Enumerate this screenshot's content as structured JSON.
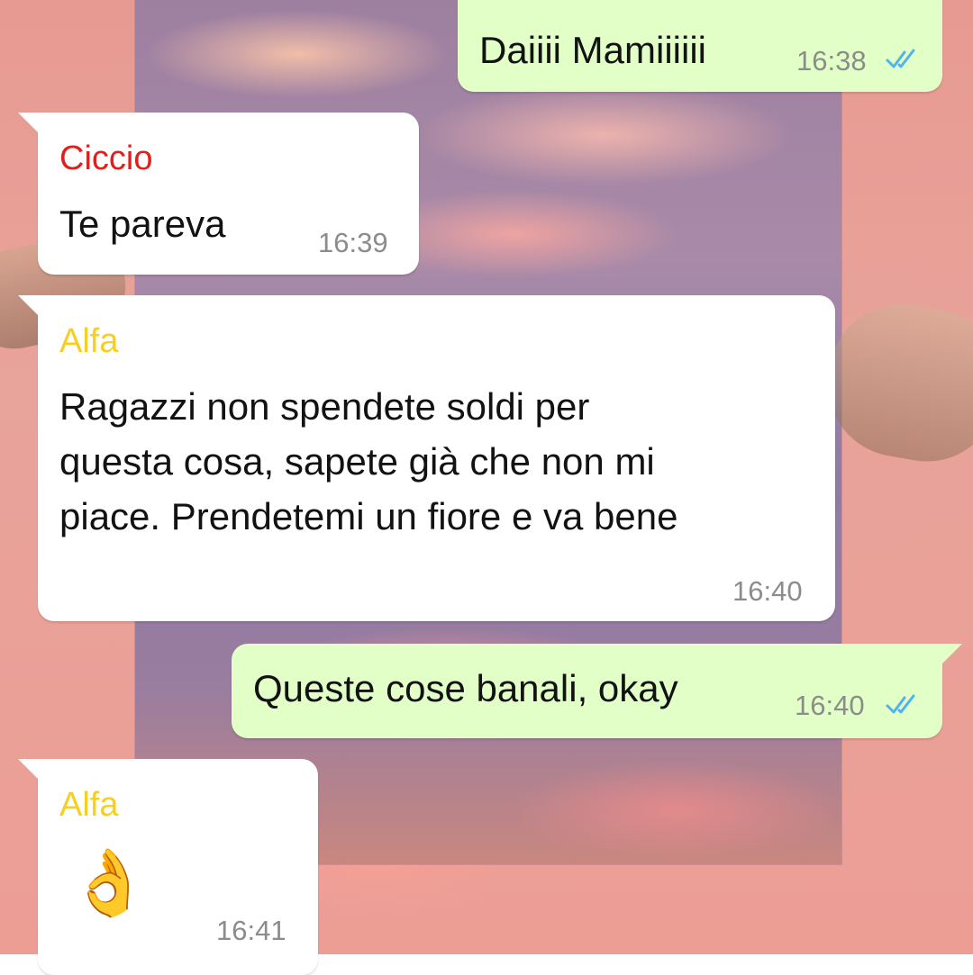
{
  "colors": {
    "incoming_bubble": "#ffffff",
    "outgoing_bubble": "#e2ffc7",
    "sender_ciccio": "#e0201c",
    "sender_alfa": "#f5d020",
    "read_ticks": "#4fb3f0",
    "timestamp": "#8c8c8c"
  },
  "messages": [
    {
      "direction": "out",
      "text": "Daiiii Mamiiiiii",
      "time": "16:38",
      "status_icon": "double-check-read-icon"
    },
    {
      "direction": "in",
      "sender": "Ciccio",
      "text": "Te pareva",
      "time": "16:39"
    },
    {
      "direction": "in",
      "sender": "Alfa",
      "lines": [
        "Ragazzi non spendete soldi per",
        "questa cosa, sapete già che non mi",
        "piace. Prendetemi un fiore e va bene"
      ],
      "time": "16:40"
    },
    {
      "direction": "out",
      "text": "Queste cose banali, okay",
      "time": "16:40",
      "status_icon": "double-check-read-icon"
    },
    {
      "direction": "in",
      "sender": "Alfa",
      "emoji": "👌",
      "time": "16:41"
    }
  ]
}
